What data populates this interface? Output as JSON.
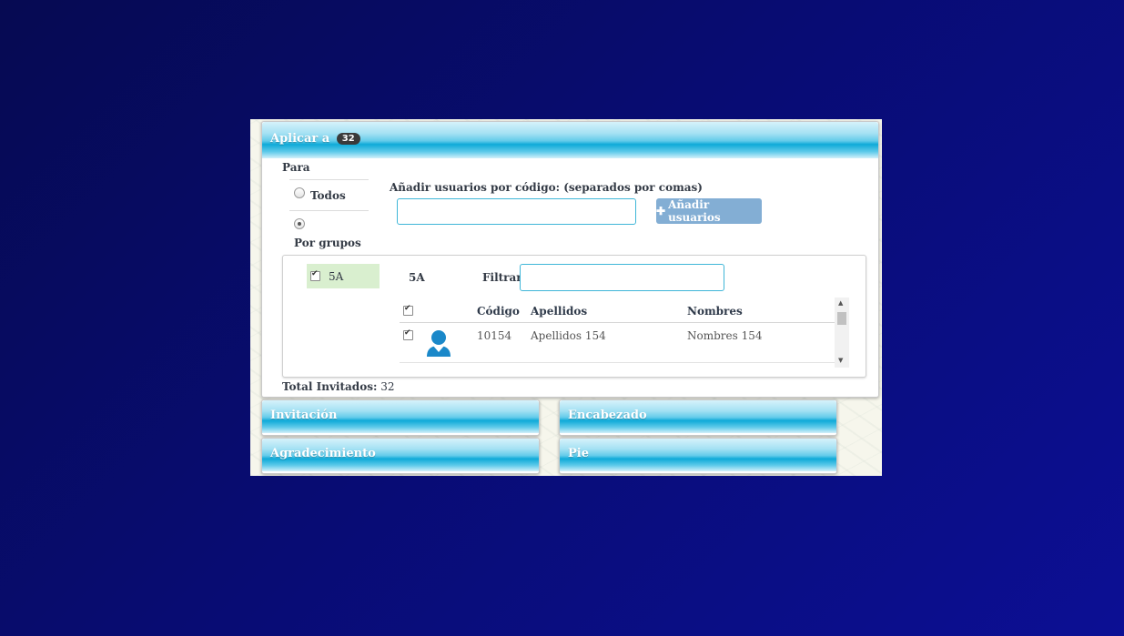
{
  "main_panel": {
    "title": "Aplicar a",
    "badge": "32"
  },
  "para": {
    "label": "Para",
    "options": [
      {
        "label": "Todos",
        "selected": false
      },
      {
        "label": "Por grupos",
        "selected": true
      }
    ]
  },
  "add_users": {
    "label": "Añadir usuarios por código: (separados por comas)",
    "input_value": "",
    "button_icon": "plus-icon",
    "button_label": "Añadir usuarios"
  },
  "groups": [
    {
      "label": "5A",
      "checked": true
    }
  ],
  "selected_group": "5A",
  "filter": {
    "label": "Filtrar",
    "value": ""
  },
  "table": {
    "columns": [
      "",
      "",
      "Código",
      "Apellidos",
      "Nombres"
    ],
    "header_checked": true,
    "rows": [
      {
        "checked": true,
        "avatar": "user-icon",
        "codigo": "10154",
        "apellidos": "Apellidos 154",
        "nombres": "Nombres 154"
      }
    ]
  },
  "total": {
    "label": "Total Invitados:",
    "value": "32"
  },
  "sections": [
    "Invitación",
    "Encabezado",
    "Agradecimiento",
    "Pie"
  ],
  "colors": {
    "header_blue": "#0faad8",
    "button_blue": "#83aed4",
    "group_selected": "#d9efcf",
    "input_border": "#3fb6d8"
  }
}
